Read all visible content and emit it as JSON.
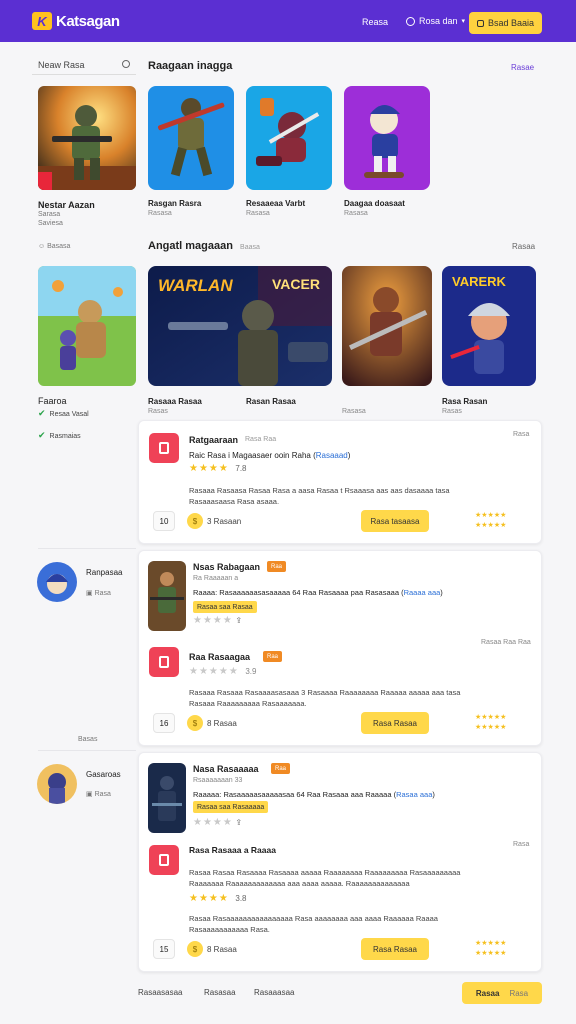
{
  "header": {
    "logo_mark": "K",
    "logo_text": "Katsagan",
    "nav_link": "Reasa",
    "lang": "Rosa dan",
    "signin": "Bsad Baaia"
  },
  "search": {
    "placeholder": "Neaw Rasa"
  },
  "sidebar": {
    "featured_title": "Nestar Aazan",
    "featured_sub1": "Sarasa",
    "featured_sub2": "Saviesa",
    "featured_meta": "Basasa",
    "item2_title": "Faaroa",
    "item2_check1": "Resaa Vasal",
    "item2_check2": "Rasmaias",
    "user1_name": "Ranpasaa",
    "user1_sub": "Rasa",
    "user1_meta": "Basas",
    "user2_name": "Gasaroas",
    "user2_sub": "Rasa"
  },
  "section1": {
    "title": "Raagaan inagga",
    "link": "Rasae",
    "games": [
      {
        "caption": "Rasgan Rasra",
        "sub": "Rasasa"
      },
      {
        "caption": "Resaaeaa Varbt",
        "sub": "Rasasa"
      },
      {
        "caption": "Daagaa doasaat",
        "sub": "Rasasa"
      }
    ]
  },
  "section2": {
    "title": "Angatl magaaan",
    "sub": "Baasa",
    "link": "Rasaa",
    "banner_text1": "WARLAN",
    "banner_text2": "VACER",
    "art_text": "VARERK",
    "games": [
      {
        "caption": "Rasaaa Rasaa",
        "sub": "Rasas"
      },
      {
        "caption": "Rasan Rasaa",
        "sub": "Rasasa"
      },
      {
        "caption": "Rasa Rasan",
        "sub": "Rasas"
      }
    ]
  },
  "review1": {
    "name": "Ratgaaraan",
    "meta": "Rasa Raa",
    "corner": "Rasa",
    "line1": "Raic Rasa i Magaasaer ooin Raha",
    "link1": "Rasaaad",
    "rating_num": "7.8",
    "rating_count": "3 Rsaaa",
    "body1": "Rasaaa Rasaasa Rasaa Rasa a aasa Rasaa t Rsaaasa aas aas dasaaaa tasa",
    "body2": "Rasaaasaasa Rasa asaaa.",
    "count": "10",
    "coin_count": "3 Rasaan",
    "btn": "Rasa tasaasa",
    "stars_right": "★★★★★"
  },
  "review2": {
    "name": "Nsas Rabagaan",
    "tag": "Raa",
    "meta": "Ra Raaaaan a",
    "line": "Raaaa: Rasaaaaaasasaaaaa 64 Raa Rasaaaa paa Rasasaaa",
    "link": "Raaaa aaa",
    "tag2": "Rasaa saa Rasaa",
    "sub_corner": "Rasaa Raa Raa",
    "name2": "Raa Rasaagaa",
    "tag3": "Raa",
    "rating_num": "3.9",
    "body1": "Rasaaa Rasaaa Rasaaaasasaaa 3 Rasaaaa Raaaaaaaa Raaaaa aaaaa aaa tasa",
    "body2": "Rasaaa Raaaaaaaaa Rasaaaaaaa.",
    "count": "16",
    "coin_count": "8 Rasaa",
    "btn": "Rasa Rasaa",
    "side_meta": "Rasa"
  },
  "review3": {
    "name": "Nasa Rasaaaaa",
    "tag": "Raa",
    "meta": "Rsaaaaaaan 33",
    "line": "Raaaaa: Rasaaaaasaaaaasaa 64 Raa Rasaaa aaa Raaaaa",
    "link": "Rasaa aaa",
    "tag2": "Rasaa saa Rasaaaaa",
    "corner": "Rasa",
    "name2": "Rasa Rasaaa a Raaaa",
    "body_a": "Rasaa Rasaa Rasaaaa Rasaaaa aaaaa Raaaaaaaa Raaaaaaaaa Rasaaaaaaaaa",
    "body_b": "Raaaaaaa Raaaaaaaaaaaaa aaa aaaa aaaaa. Raaaaaaaaaaaaaa",
    "rating_num": "3.8",
    "body1": "Rasaa Rasaaaaaaaaaaaaaaaa Rasa aaaaaaaa aaa aaaa Raaaaaa Raaaa",
    "body2": "Rasaaaaaaaaaaa Rasa.",
    "count": "15",
    "coin_count": "8 Rasaa",
    "btn": "Rasa Rasaa"
  },
  "footer": {
    "link1": "Rasaasasaa",
    "link2": "Rasasaa",
    "link3": "Rasaaasaa",
    "btn_main": "Rasaa",
    "btn_sub": "Rasa"
  },
  "colors": {
    "brand": "#5b2fd2",
    "accent": "#ffd84a",
    "badge": "#ef4257"
  }
}
